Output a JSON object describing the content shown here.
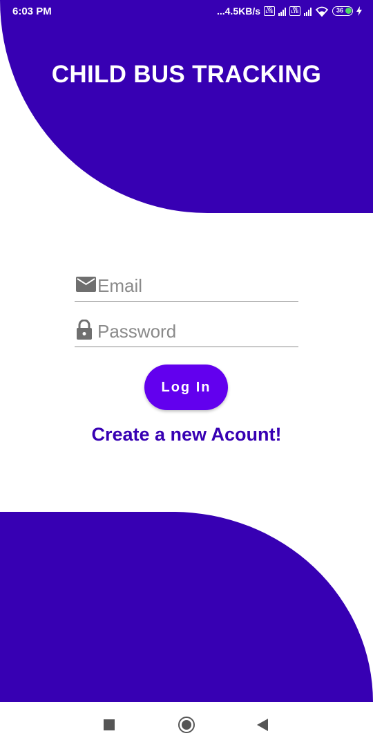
{
  "status_bar": {
    "time": "6:03 PM",
    "speed": "...4.5KB/s",
    "battery": "36",
    "icons": [
      "volte-icon",
      "signal-icon",
      "volte-icon",
      "signal-icon",
      "wifi-icon",
      "battery-icon",
      "charging-icon"
    ]
  },
  "header": {
    "title": "CHILD BUS TRACKING"
  },
  "form": {
    "email_placeholder": "Email",
    "password_placeholder": "Password",
    "login_label": "Log In",
    "create_account_label": "Create a new Acount!"
  },
  "nav": {
    "icons": [
      "recent-apps-icon",
      "home-icon",
      "back-icon"
    ]
  },
  "colors": {
    "primary_dark": "#3700b3",
    "primary": "#6200ee",
    "background": "#ffffff"
  }
}
